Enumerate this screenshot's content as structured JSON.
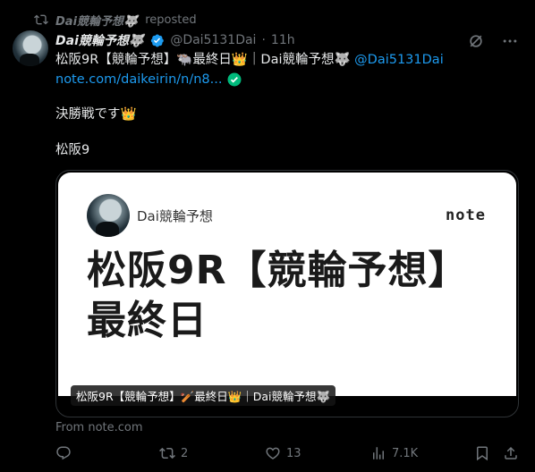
{
  "repost": {
    "name": "Dai競輪予想🐺",
    "label": "reposted"
  },
  "post": {
    "display_name": "Dai競輪予想🐺",
    "handle": "@Dai5131Dai",
    "separator": "·",
    "time": "11h",
    "line1_text": "松阪9R【競輪予想】🐃最終日👑｜Dai競輪予想🐺",
    "line1_mention": "@Dai5131Dai",
    "link_text": "note.com/daikeirin/n/n8...",
    "body_line1": "決勝戦です👑",
    "body_line2": "松阪9"
  },
  "card": {
    "author": "Dai競輪予想",
    "site_logo": "note",
    "headline": "松阪9R【競輪予想】最終日",
    "overlay_title": "松阪9R【競輪予想】🏏最終日👑｜Dai競輪予想🐺",
    "source": "From note.com"
  },
  "stats": {
    "replies": "",
    "reposts": "2",
    "likes": "13",
    "views": "7.1K"
  },
  "colors": {
    "accent": "#1d9bf0",
    "muted": "#71767b",
    "verified": "#1d9bf0",
    "link_check": "#00ba7c"
  }
}
